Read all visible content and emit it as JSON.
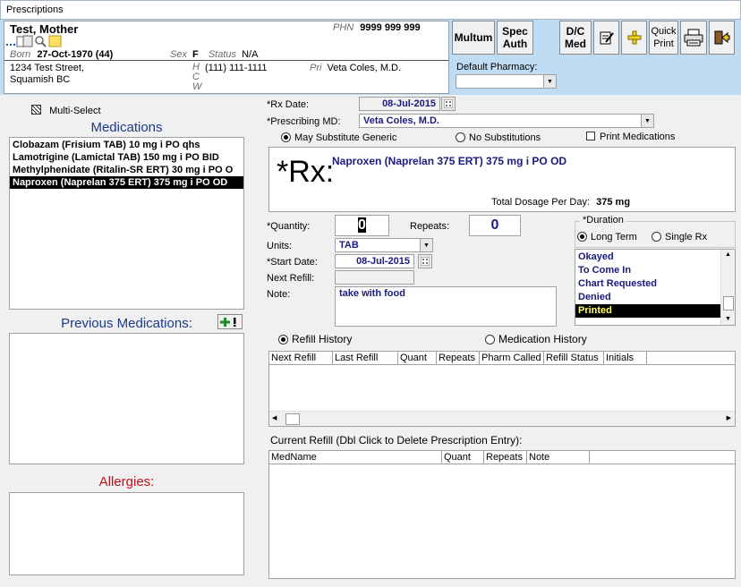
{
  "window": {
    "title": "Prescriptions"
  },
  "patient": {
    "name": "Test, Mother",
    "phn_label": "PHN",
    "phn": "9999 999 999",
    "born_label": "Born",
    "born": "27-Oct-1970 (44)",
    "sex_label": "Sex",
    "sex": "F",
    "status_label": "Status",
    "status": "N/A",
    "address_line1": "1234 Test Street,",
    "address_line2": "Squamish BC",
    "phone_labels": [
      "H",
      "C",
      "W"
    ],
    "phone_h": "(111) 111-1111",
    "pri_label": "Pri",
    "pri": "Veta Coles, M.D."
  },
  "toolbar": {
    "multum": "Multum",
    "spec_auth": "Spec Auth",
    "dc_med": "D/C Med",
    "quick_print": "Quick Print",
    "default_pharmacy_label": "Default Pharmacy:",
    "default_pharmacy_value": ""
  },
  "left": {
    "multi_select": "Multi-Select",
    "medications_title": "Medications",
    "medications": [
      "Clobazam (Frisium TAB) 10  mg   i PO  qhs",
      "Lamotrigine (Lamictal TAB) 150  mg   i PO  BID",
      "Methylphenidate (Ritalin-SR ERT) 30  mg   i PO  O",
      "Naproxen (Naprelan 375 ERT) 375  mg   i PO  OD"
    ],
    "previous_title": "Previous Medications:",
    "allergies_title": "Allergies:"
  },
  "form": {
    "rx_date_label": "*Rx Date:",
    "rx_date": "08-Jul-2015",
    "prescribing_md_label": "*Prescribing MD:",
    "prescribing_md": "Veta  Coles, M.D.",
    "may_substitute": "May Substitute Generic",
    "no_substitutions": "No Substitutions",
    "print_medications": "Print Medications",
    "rx_symbol": "*Rx:",
    "rx_text": "Naproxen (Naprelan 375 ERT) 375  mg   i PO  OD",
    "total_dosage_label": "Total Dosage Per Day:",
    "total_dosage": "375 mg",
    "quantity_label": "*Quantity:",
    "quantity": "0",
    "repeats_label": "Repeats:",
    "repeats": "0",
    "units_label": "Units:",
    "units": "TAB",
    "start_date_label": "*Start Date:",
    "start_date": "08-Jul-2015",
    "next_refill_label": "Next Refill:",
    "next_refill": "",
    "note_label": "Note:",
    "note": "take with food"
  },
  "duration": {
    "title": "*Duration",
    "long_term": "Long Term",
    "single_rx": "Single Rx",
    "statuses": [
      "Okayed",
      "To Come In",
      "Chart Requested",
      "Denied",
      "Printed"
    ]
  },
  "history": {
    "refill_history": "Refill History",
    "medication_history": "Medication History",
    "columns": [
      "Next Refill",
      "Last Refill",
      "Quant",
      "Repeats",
      "Pharm Called",
      "Refill Status",
      "Initials"
    ],
    "current_refill_title": "Current Refill (Dbl Click to Delete Prescription Entry):",
    "current_columns": [
      "MedName",
      "Quant",
      "Repeats",
      "Note"
    ]
  }
}
